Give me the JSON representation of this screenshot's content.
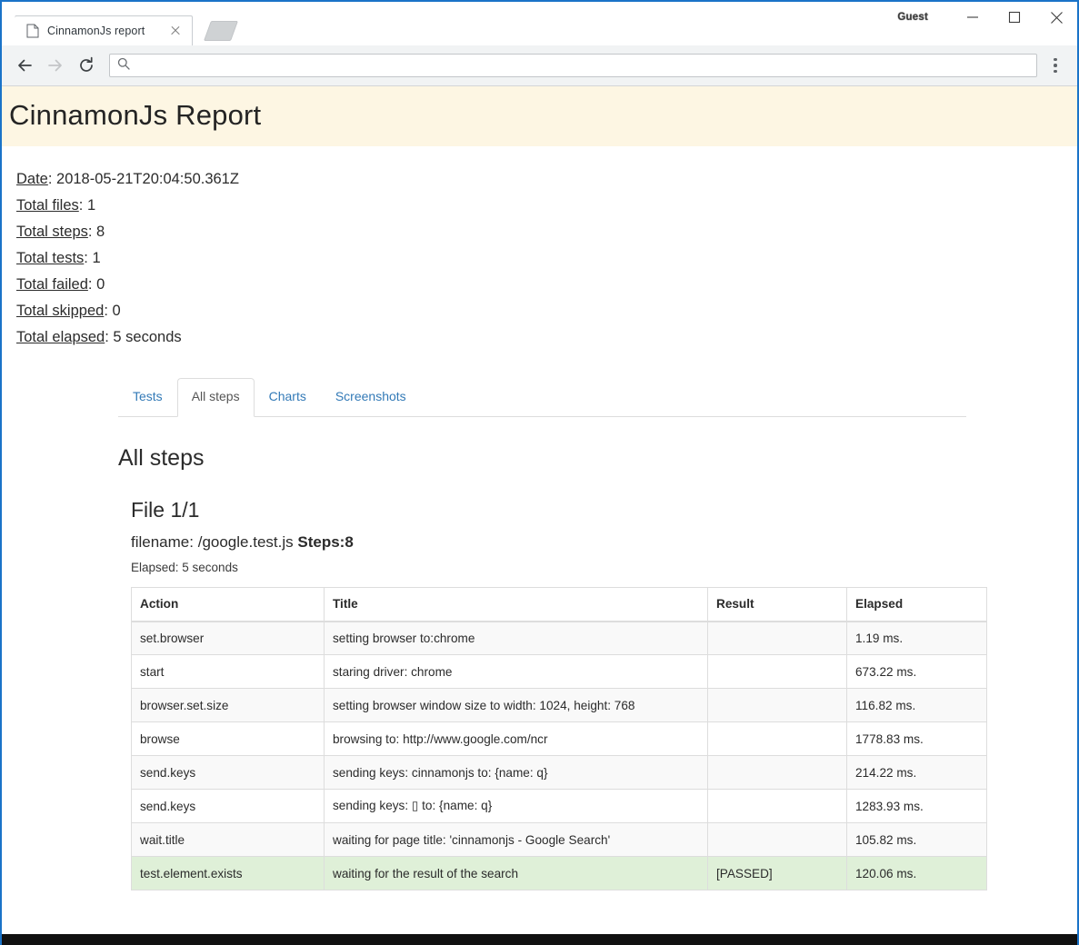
{
  "browser": {
    "tab": {
      "title": "CinnamonJs report",
      "favicon_icon": "page-icon",
      "close_icon": "close-icon"
    },
    "new_tab_icon": "new-tab-icon",
    "caption": {
      "profile_label": "Guest",
      "minimize_icon": "minimize-icon",
      "maximize_icon": "maximize-icon",
      "close_icon": "window-close-icon"
    },
    "toolbar": {
      "back_icon": "back-arrow-icon",
      "forward_icon": "forward-arrow-icon",
      "reload_icon": "reload-icon",
      "search_icon": "search-icon",
      "address_value": "",
      "address_placeholder": "",
      "menu_icon": "three-dot-menu-icon"
    }
  },
  "report": {
    "title": "CinnamonJs Report",
    "banner_color": "#fdf6e3",
    "summary": [
      {
        "label": "Date",
        "value": "2018-05-21T20:04:50.361Z"
      },
      {
        "label": "Total files",
        "value": "1"
      },
      {
        "label": "Total steps",
        "value": "8"
      },
      {
        "label": "Total tests",
        "value": "1"
      },
      {
        "label": "Total failed",
        "value": "0"
      },
      {
        "label": "Total skipped",
        "value": "0"
      },
      {
        "label": "Total elapsed",
        "value": "5 seconds"
      }
    ],
    "tabs": [
      {
        "label": "Tests",
        "active": false
      },
      {
        "label": "All steps",
        "active": true
      },
      {
        "label": "Charts",
        "active": false
      },
      {
        "label": "Screenshots",
        "active": false
      }
    ],
    "panel": {
      "heading": "All steps",
      "file_heading": "File 1/1",
      "filename_label": "filename:",
      "filename_value": "/google.test.js",
      "steps_label": "Steps:8",
      "elapsed_line": "Elapsed: 5 seconds"
    },
    "table": {
      "columns": [
        "Action",
        "Title",
        "Result",
        "Elapsed"
      ],
      "rows": [
        {
          "action": "set.browser",
          "title": "setting browser to:chrome",
          "result": "",
          "elapsed": "1.19 ms.",
          "passed": false
        },
        {
          "action": "start",
          "title": "staring driver: chrome",
          "result": "",
          "elapsed": "673.22 ms.",
          "passed": false
        },
        {
          "action": "browser.set.size",
          "title": "setting browser window size to width: 1024, height: 768",
          "result": "",
          "elapsed": "116.82 ms.",
          "passed": false
        },
        {
          "action": "browse",
          "title": "browsing to: http://www.google.com/ncr",
          "result": "",
          "elapsed": "1778.83 ms.",
          "passed": false
        },
        {
          "action": "send.keys",
          "title": "sending keys: cinnamonjs to: {name: q}",
          "result": "",
          "elapsed": "214.22 ms.",
          "passed": false
        },
        {
          "action": "send.keys",
          "title": "sending keys: ▯ to: {name: q}",
          "result": "",
          "elapsed": "1283.93 ms.",
          "passed": false
        },
        {
          "action": "wait.title",
          "title": "waiting for page title: 'cinnamonjs - Google Search'",
          "result": "",
          "elapsed": "105.82 ms.",
          "passed": false
        },
        {
          "action": "test.element.exists",
          "title": "waiting for the result of the search",
          "result": "[PASSED]",
          "elapsed": "120.06 ms.",
          "passed": true
        }
      ],
      "passed_row_color": "#dff0d8",
      "stripe_color": "#f9f9f9"
    }
  }
}
